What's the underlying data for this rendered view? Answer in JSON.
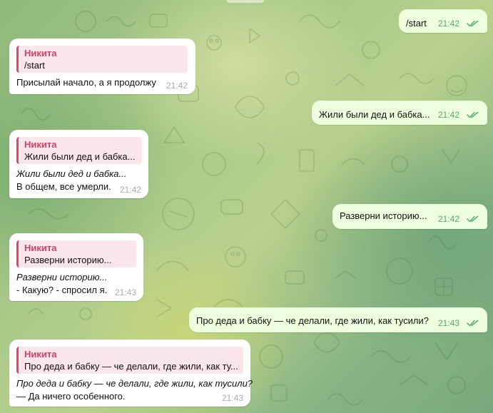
{
  "chat": {
    "accent_reply_color": "#e2456b",
    "outgoing_bubble_color": "#eeffde",
    "incoming_bubble_color": "#ffffff",
    "messages": [
      {
        "direction": "outgoing",
        "text": "/start",
        "time": "21:42",
        "status": "read",
        "status_icon": "double-check-icon"
      },
      {
        "direction": "incoming",
        "reply_to": {
          "name": "Никита",
          "text": "/start"
        },
        "lines": [
          "Присылай начало, а я продолжу"
        ],
        "time": "21:42"
      },
      {
        "direction": "outgoing",
        "text": "Жили были дед и бабка...",
        "time": "21:42",
        "status": "read",
        "status_icon": "double-check-icon"
      },
      {
        "direction": "incoming",
        "reply_to": {
          "name": "Никита",
          "text": "Жили были дед и бабка..."
        },
        "lines": [
          "Жили были дед и бабка...",
          "В общем, все умерли."
        ],
        "time": "21:42"
      },
      {
        "direction": "outgoing",
        "text": "Разверни историю...",
        "time": "21:42",
        "status": "read",
        "status_icon": "double-check-icon"
      },
      {
        "direction": "incoming",
        "reply_to": {
          "name": "Никита",
          "text": "Разверни историю..."
        },
        "lines": [
          "Разверни историю...",
          "- Какую? - спросил я."
        ],
        "time": "21:43"
      },
      {
        "direction": "outgoing",
        "text": "Про деда и бабку — че делали, где жили, как тусили?",
        "time": "21:43",
        "status": "read",
        "status_icon": "double-check-icon"
      },
      {
        "direction": "incoming",
        "reply_to": {
          "name": "Никита",
          "text": "Про деда и бабку — че делали, где жили, как ту..."
        },
        "lines": [
          "Про деда и бабку — че делали, где жили, как тусили?",
          "— Да ничего особенного."
        ],
        "time": "21:43"
      }
    ]
  }
}
